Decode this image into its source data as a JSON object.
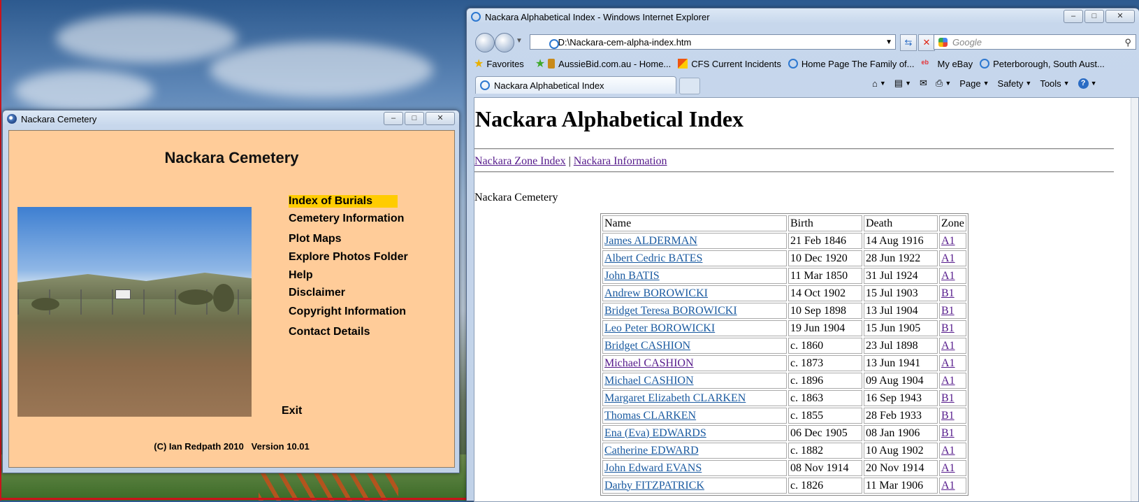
{
  "app": {
    "window_title": "Nackara Cemetery",
    "heading": "Nackara Cemetery",
    "menu": [
      {
        "label": "Index of Burials",
        "selected": true
      },
      {
        "label": "Cemetery Information"
      },
      {
        "label": "Plot Maps"
      },
      {
        "label": "Explore Photos Folder"
      },
      {
        "label": "Help"
      },
      {
        "label": "Disclaimer"
      },
      {
        "label": "Copyright Information"
      },
      {
        "label": "Contact Details"
      }
    ],
    "exit_label": "Exit",
    "copyright": "(C) Ian Redpath 2010   Version 10.01",
    "highlight_color": "#ffcc00",
    "background_color": "#ffcc99"
  },
  "ie": {
    "window_title": "Nackara Alphabetical Index - Windows Internet Explorer",
    "address": "D:\\Nackara-cem-alpha-index.htm",
    "search_placeholder": "Google",
    "favorites": [
      {
        "label": "Favorites",
        "icon": "star-icon"
      },
      {
        "label": "AussieBid.com.au - Home...",
        "icon": "hammer-icon"
      },
      {
        "label": "CFS  Current Incidents",
        "icon": "cfs-icon"
      },
      {
        "label": "Home Page The Family of...",
        "icon": "ie-page-icon"
      },
      {
        "label": "My eBay",
        "icon": "ebay-icon"
      },
      {
        "label": "Peterborough, South Aust...",
        "icon": "ie-page-icon"
      }
    ],
    "tab_label": "Nackara Alphabetical Index",
    "commands": [
      "Page",
      "Safety",
      "Tools"
    ]
  },
  "page": {
    "heading": "Nackara Alphabetical Index",
    "link_zone": "Nackara Zone Index",
    "separator": "|",
    "link_info": "Nackara Information",
    "subtitle": "Nackara Cemetery",
    "columns": [
      "Name",
      "Birth",
      "Death",
      "Zone"
    ],
    "rows": [
      [
        "James ALDERMAN",
        "21 Feb 1846",
        "14 Aug 1916",
        "A1"
      ],
      [
        "Albert Cedric BATES",
        "10 Dec 1920",
        "28 Jun 1922",
        "A1"
      ],
      [
        "John BATIS",
        "11 Mar 1850",
        "31 Jul 1924",
        "A1"
      ],
      [
        "Andrew BOROWICKI",
        "14 Oct 1902",
        "15 Jul 1903",
        "B1"
      ],
      [
        "Bridget Teresa BOROWICKI",
        "10 Sep 1898",
        "13 Jul 1904",
        "B1"
      ],
      [
        "Leo Peter BOROWICKI",
        "19 Jun 1904",
        "15 Jun 1905",
        "B1"
      ],
      [
        "Bridget CASHION",
        "c. 1860",
        "23 Jul 1898",
        "A1"
      ],
      [
        "Michael CASHION",
        "c. 1873",
        "13 Jun 1941",
        "A1"
      ],
      [
        "Michael CASHION",
        "c. 1896",
        "09 Aug 1904",
        "A1"
      ],
      [
        "Margaret Elizabeth CLARKEN",
        "c. 1863",
        "16 Sep 1943",
        "B1"
      ],
      [
        "Thomas CLARKEN",
        "c. 1855",
        "28 Feb 1933",
        "B1"
      ],
      [
        "Ena (Eva) EDWARDS",
        "06 Dec 1905",
        "08 Jan 1906",
        "B1"
      ],
      [
        "Catherine EDWARD",
        "c. 1882",
        "10 Aug 1902",
        "A1"
      ],
      [
        "John Edward EVANS",
        "08 Nov 1914",
        "20 Nov 1914",
        "A1"
      ],
      [
        "Darby FITZPATRICK",
        "c. 1826",
        "11 Mar 1906",
        "A1"
      ]
    ],
    "visited_rows": [
      7
    ],
    "link_color": "#1a5aa0",
    "visited_color": "#551a8b"
  }
}
